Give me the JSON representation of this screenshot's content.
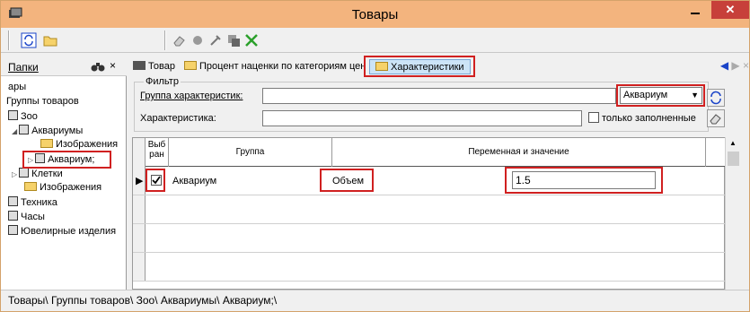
{
  "window": {
    "title": "Товары",
    "close_glyph": "✕"
  },
  "toolbar": {
    "icons": [
      "refresh-icon",
      "open-folder-icon",
      "eraser-icon",
      "paint-icon",
      "tools-icon",
      "copy-icon",
      "check-icon"
    ]
  },
  "sidebar": {
    "header_label": "Папки",
    "close_glyph": "×",
    "tree": [
      {
        "label": "ары"
      },
      {
        "label": "Группы товаров"
      },
      {
        "label": "Зоо"
      },
      {
        "label": "Аквариумы"
      },
      {
        "label": "Изображения"
      },
      {
        "label": "Аквариум;"
      },
      {
        "label": "Клетки"
      },
      {
        "label": "Изображения"
      },
      {
        "label": "Техника"
      },
      {
        "label": "Часы"
      },
      {
        "label": "Ювелирные изделия"
      }
    ]
  },
  "tabs": [
    {
      "label": "Товар"
    },
    {
      "label": "Процент наценки по категориям цен"
    },
    {
      "label": "Характеристики"
    }
  ],
  "filter": {
    "legend": "Фильтр",
    "group_label": "Группа характеристик:",
    "group_value": "",
    "group_select": "Аквариум",
    "char_label": "Характеристика:",
    "char_value": "",
    "only_filled_label": "только заполненные"
  },
  "grid": {
    "columns": [
      "Выб ран",
      "Группа",
      "Переменная и значение"
    ],
    "rows": [
      {
        "selected": true,
        "group": "Аквариум",
        "variable": "Объем",
        "value": "1.5"
      }
    ]
  },
  "statusbar": {
    "path": "Товары\\ Группы товаров\\ Зоо\\ Аквариумы\\ Аквариум;\\"
  },
  "colors": {
    "titlebar": "#f3b47e",
    "highlight": "#d02020",
    "active_tab": "#cce4f7",
    "close": "#c7403a"
  }
}
